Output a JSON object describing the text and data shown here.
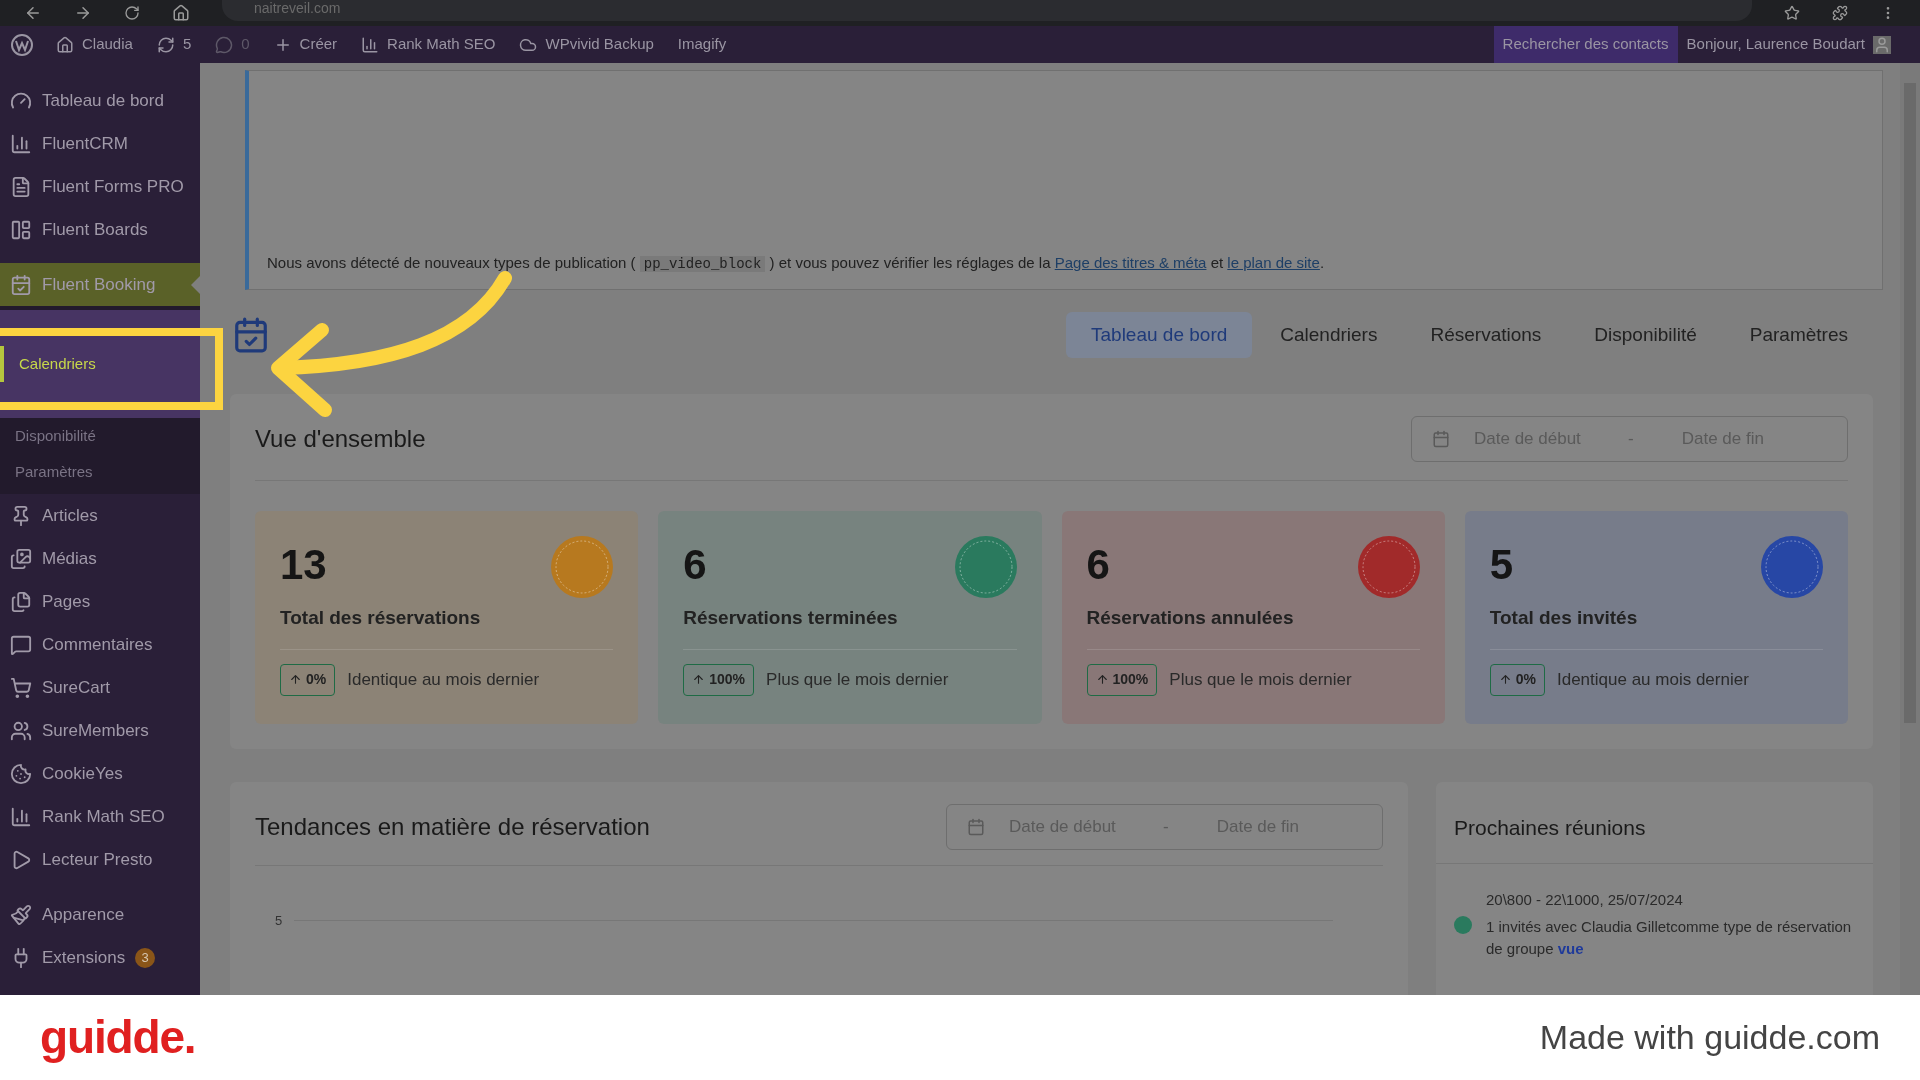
{
  "browser": {
    "url": "naitreveil.com"
  },
  "admin_bar": {
    "items": [
      {
        "label": "Claudia"
      },
      {
        "label": "5"
      },
      {
        "label": "0",
        "disabled": true
      },
      {
        "label": "Créer"
      },
      {
        "label": "Rank Math SEO"
      },
      {
        "label": "WPvivid Backup"
      },
      {
        "label": "Imagify"
      }
    ],
    "search_contacts": "Rechercher des contacts",
    "greeting": "Bonjour, Laurence Boudart"
  },
  "sidebar": {
    "items": [
      {
        "label": "Tableau de bord",
        "selected": false
      },
      {
        "label": "FluentCRM",
        "selected": false
      },
      {
        "label": "Fluent Forms PRO",
        "selected": false
      },
      {
        "label": "Fluent Boards",
        "selected": false
      },
      {
        "label": "Fluent Booking",
        "selected": true,
        "children": [
          {
            "label": "Calendriers",
            "selected": true
          },
          {
            "label": "Disponibilité",
            "selected": false
          },
          {
            "label": "Paramètres",
            "selected": false
          }
        ]
      },
      {
        "label": "Articles",
        "selected": false
      },
      {
        "label": "Médias",
        "selected": false
      },
      {
        "label": "Pages",
        "selected": false
      },
      {
        "label": "Commentaires",
        "selected": false
      },
      {
        "label": "SureCart",
        "selected": false
      },
      {
        "label": "SureMembers",
        "selected": false
      },
      {
        "label": "CookieYes",
        "selected": false
      },
      {
        "label": "Rank Math SEO",
        "selected": false
      },
      {
        "label": "Lecteur Presto",
        "selected": false
      },
      {
        "label": "Apparence",
        "selected": false
      },
      {
        "label": "Extensions",
        "selected": false,
        "badge": "3"
      }
    ]
  },
  "notice": {
    "before": "Nous avons détecté de nouveaux types de publication (",
    "code": "pp_video_block",
    "middle": ") et vous pouvez vérifier les réglages de la",
    "link_1": "Page des titres & méta",
    "and": "et",
    "link_2": "le plan de site",
    "end": "."
  },
  "tabs": [
    {
      "label": "Tableau de bord",
      "selected": true
    },
    {
      "label": "Calendriers",
      "selected": false
    },
    {
      "label": "Réservations",
      "selected": false
    },
    {
      "label": "Disponibilité",
      "selected": false
    },
    {
      "label": "Paramètres",
      "selected": false
    }
  ],
  "overview": {
    "title": "Vue d'ensemble",
    "date_start": {
      "placeholder": "Date de début"
    },
    "separator": "-",
    "date_end": {
      "placeholder": "Date de fin"
    },
    "cards": [
      {
        "value": "13",
        "label": "Total des réservations",
        "change": "0%",
        "note": "Identique au mois dernier",
        "color": "#b7791f"
      },
      {
        "value": "6",
        "label": "Réservations terminées",
        "change": "100%",
        "note": "Plus que le mois dernier",
        "color": "#2a7a5e"
      },
      {
        "value": "6",
        "label": "Réservations annulées",
        "change": "100%",
        "note": "Plus que le mois dernier",
        "color": "#a12a2a"
      },
      {
        "value": "5",
        "label": "Total des invités",
        "change": "0%",
        "note": "Identique au mois dernier",
        "color": "#2747a5"
      }
    ]
  },
  "trends": {
    "title": "Tendances en matière de réservation",
    "date_start": {
      "placeholder": "Date de début"
    },
    "separator": "-",
    "date_end": {
      "placeholder": "Date de fin"
    },
    "y_tick": "5"
  },
  "meetings": {
    "title": "Prochaines réunions",
    "items": [
      {
        "time": "20\\800 - 22\\1000, 25/07/2024",
        "text": "1 invités avec Claudia Gilletcomme type de réservation de groupe",
        "link": "vue",
        "color": "#2a7a5e"
      }
    ]
  },
  "footer": {
    "brand": "guidde.",
    "credit": "Made with guidde.com"
  }
}
